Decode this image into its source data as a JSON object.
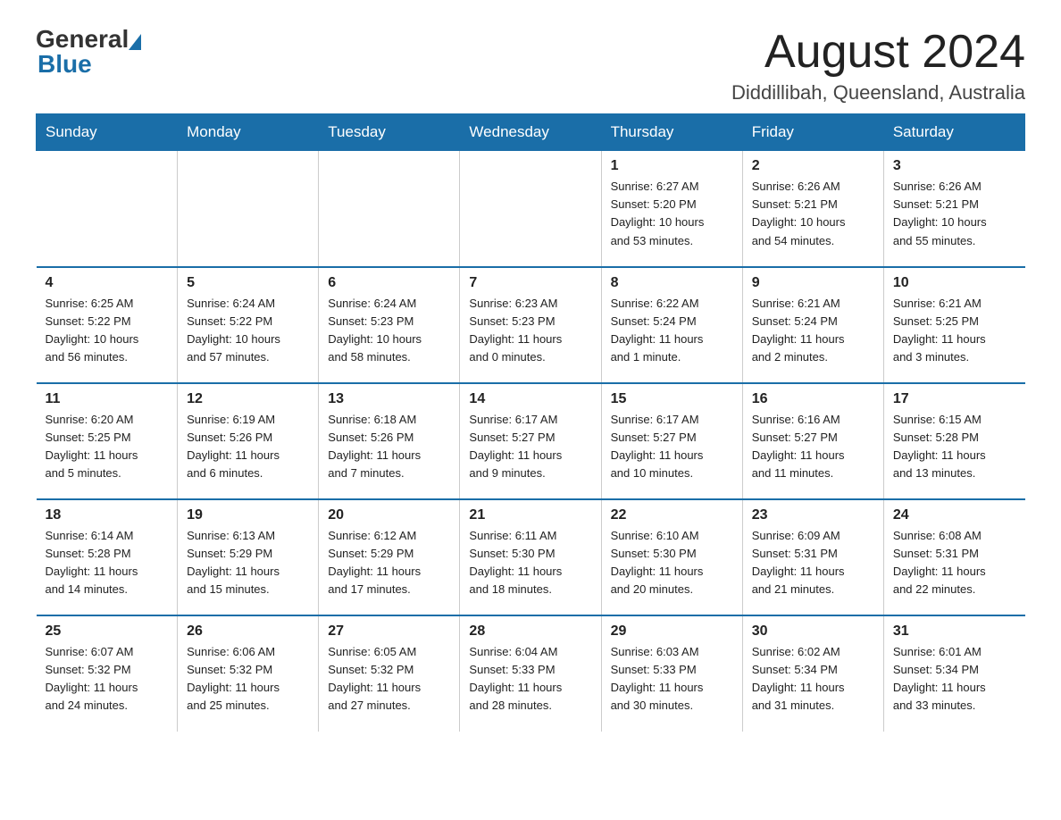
{
  "header": {
    "logo_general": "General",
    "logo_blue": "Blue",
    "title": "August 2024",
    "subtitle": "Diddillibah, Queensland, Australia"
  },
  "days_of_week": [
    "Sunday",
    "Monday",
    "Tuesday",
    "Wednesday",
    "Thursday",
    "Friday",
    "Saturday"
  ],
  "weeks": [
    [
      {
        "day": "",
        "info": ""
      },
      {
        "day": "",
        "info": ""
      },
      {
        "day": "",
        "info": ""
      },
      {
        "day": "",
        "info": ""
      },
      {
        "day": "1",
        "info": "Sunrise: 6:27 AM\nSunset: 5:20 PM\nDaylight: 10 hours\nand 53 minutes."
      },
      {
        "day": "2",
        "info": "Sunrise: 6:26 AM\nSunset: 5:21 PM\nDaylight: 10 hours\nand 54 minutes."
      },
      {
        "day": "3",
        "info": "Sunrise: 6:26 AM\nSunset: 5:21 PM\nDaylight: 10 hours\nand 55 minutes."
      }
    ],
    [
      {
        "day": "4",
        "info": "Sunrise: 6:25 AM\nSunset: 5:22 PM\nDaylight: 10 hours\nand 56 minutes."
      },
      {
        "day": "5",
        "info": "Sunrise: 6:24 AM\nSunset: 5:22 PM\nDaylight: 10 hours\nand 57 minutes."
      },
      {
        "day": "6",
        "info": "Sunrise: 6:24 AM\nSunset: 5:23 PM\nDaylight: 10 hours\nand 58 minutes."
      },
      {
        "day": "7",
        "info": "Sunrise: 6:23 AM\nSunset: 5:23 PM\nDaylight: 11 hours\nand 0 minutes."
      },
      {
        "day": "8",
        "info": "Sunrise: 6:22 AM\nSunset: 5:24 PM\nDaylight: 11 hours\nand 1 minute."
      },
      {
        "day": "9",
        "info": "Sunrise: 6:21 AM\nSunset: 5:24 PM\nDaylight: 11 hours\nand 2 minutes."
      },
      {
        "day": "10",
        "info": "Sunrise: 6:21 AM\nSunset: 5:25 PM\nDaylight: 11 hours\nand 3 minutes."
      }
    ],
    [
      {
        "day": "11",
        "info": "Sunrise: 6:20 AM\nSunset: 5:25 PM\nDaylight: 11 hours\nand 5 minutes."
      },
      {
        "day": "12",
        "info": "Sunrise: 6:19 AM\nSunset: 5:26 PM\nDaylight: 11 hours\nand 6 minutes."
      },
      {
        "day": "13",
        "info": "Sunrise: 6:18 AM\nSunset: 5:26 PM\nDaylight: 11 hours\nand 7 minutes."
      },
      {
        "day": "14",
        "info": "Sunrise: 6:17 AM\nSunset: 5:27 PM\nDaylight: 11 hours\nand 9 minutes."
      },
      {
        "day": "15",
        "info": "Sunrise: 6:17 AM\nSunset: 5:27 PM\nDaylight: 11 hours\nand 10 minutes."
      },
      {
        "day": "16",
        "info": "Sunrise: 6:16 AM\nSunset: 5:27 PM\nDaylight: 11 hours\nand 11 minutes."
      },
      {
        "day": "17",
        "info": "Sunrise: 6:15 AM\nSunset: 5:28 PM\nDaylight: 11 hours\nand 13 minutes."
      }
    ],
    [
      {
        "day": "18",
        "info": "Sunrise: 6:14 AM\nSunset: 5:28 PM\nDaylight: 11 hours\nand 14 minutes."
      },
      {
        "day": "19",
        "info": "Sunrise: 6:13 AM\nSunset: 5:29 PM\nDaylight: 11 hours\nand 15 minutes."
      },
      {
        "day": "20",
        "info": "Sunrise: 6:12 AM\nSunset: 5:29 PM\nDaylight: 11 hours\nand 17 minutes."
      },
      {
        "day": "21",
        "info": "Sunrise: 6:11 AM\nSunset: 5:30 PM\nDaylight: 11 hours\nand 18 minutes."
      },
      {
        "day": "22",
        "info": "Sunrise: 6:10 AM\nSunset: 5:30 PM\nDaylight: 11 hours\nand 20 minutes."
      },
      {
        "day": "23",
        "info": "Sunrise: 6:09 AM\nSunset: 5:31 PM\nDaylight: 11 hours\nand 21 minutes."
      },
      {
        "day": "24",
        "info": "Sunrise: 6:08 AM\nSunset: 5:31 PM\nDaylight: 11 hours\nand 22 minutes."
      }
    ],
    [
      {
        "day": "25",
        "info": "Sunrise: 6:07 AM\nSunset: 5:32 PM\nDaylight: 11 hours\nand 24 minutes."
      },
      {
        "day": "26",
        "info": "Sunrise: 6:06 AM\nSunset: 5:32 PM\nDaylight: 11 hours\nand 25 minutes."
      },
      {
        "day": "27",
        "info": "Sunrise: 6:05 AM\nSunset: 5:32 PM\nDaylight: 11 hours\nand 27 minutes."
      },
      {
        "day": "28",
        "info": "Sunrise: 6:04 AM\nSunset: 5:33 PM\nDaylight: 11 hours\nand 28 minutes."
      },
      {
        "day": "29",
        "info": "Sunrise: 6:03 AM\nSunset: 5:33 PM\nDaylight: 11 hours\nand 30 minutes."
      },
      {
        "day": "30",
        "info": "Sunrise: 6:02 AM\nSunset: 5:34 PM\nDaylight: 11 hours\nand 31 minutes."
      },
      {
        "day": "31",
        "info": "Sunrise: 6:01 AM\nSunset: 5:34 PM\nDaylight: 11 hours\nand 33 minutes."
      }
    ]
  ]
}
